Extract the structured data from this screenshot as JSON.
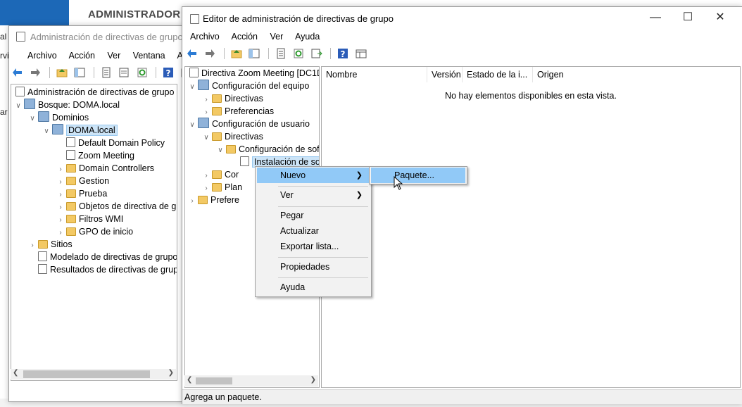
{
  "background": {
    "title": "ADMINISTRADOR D",
    "left_fragments": [
      "al",
      "rvi",
      "ar"
    ]
  },
  "gpmc": {
    "title": "Administración de directivas de grupo",
    "menu": [
      "Archivo",
      "Acción",
      "Ver",
      "Ventana",
      "Ayu"
    ],
    "tree": [
      {
        "label": "Administración de directivas de grupo",
        "icon": "gpmc-icon"
      },
      {
        "label": "Bosque: DOMA.local",
        "icon": "forest-icon"
      },
      {
        "label": "Dominios",
        "icon": "domains-icon"
      },
      {
        "label": "DOMA.local",
        "icon": "domain-icon"
      },
      {
        "label": "Default Domain Policy",
        "icon": "gpo-link-icon"
      },
      {
        "label": "Zoom Meeting",
        "icon": "gpo-link-icon"
      },
      {
        "label": "Domain Controllers",
        "icon": "ou-icon"
      },
      {
        "label": "Gestion",
        "icon": "ou-icon"
      },
      {
        "label": "Prueba",
        "icon": "ou-icon"
      },
      {
        "label": "Objetos de directiva de gr",
        "icon": "folder-icon"
      },
      {
        "label": "Filtros WMI",
        "icon": "folder-icon"
      },
      {
        "label": "GPO de inicio",
        "icon": "folder-icon"
      },
      {
        "label": "Sitios",
        "icon": "sites-icon"
      },
      {
        "label": "Modelado de directivas de grupo",
        "icon": "modeling-icon"
      },
      {
        "label": "Resultados de directivas de grupo",
        "icon": "results-icon"
      }
    ]
  },
  "editor": {
    "title": "Editor de administración de directivas de grupo",
    "menu": [
      "Archivo",
      "Acción",
      "Ver",
      "Ayuda"
    ],
    "tree": [
      {
        "label": "Directiva Zoom Meeting [DC1D"
      },
      {
        "label": "Configuración del equipo"
      },
      {
        "label": "Directivas"
      },
      {
        "label": "Preferencias"
      },
      {
        "label": "Configuración de usuario"
      },
      {
        "label": "Directivas"
      },
      {
        "label": "Configuración de sof"
      },
      {
        "label": "Instalación de sof"
      },
      {
        "label": "Cor"
      },
      {
        "label": "Plan"
      },
      {
        "label": "Prefere"
      }
    ],
    "columns": [
      "Nombre",
      "Versión",
      "Estado de la i...",
      "Origen"
    ],
    "empty_message": "No hay elementos disponibles en esta vista.",
    "status": "Agrega un paquete."
  },
  "context_menu": {
    "items": [
      "Nuevo",
      "Ver",
      "Pegar",
      "Actualizar",
      "Exportar lista...",
      "Propiedades",
      "Ayuda"
    ],
    "submenu": [
      "Paquete..."
    ]
  },
  "colors": {
    "highlight": "#91c9f7",
    "selection": "#cce4f7",
    "server_manager_blue": "#1c68b7"
  }
}
